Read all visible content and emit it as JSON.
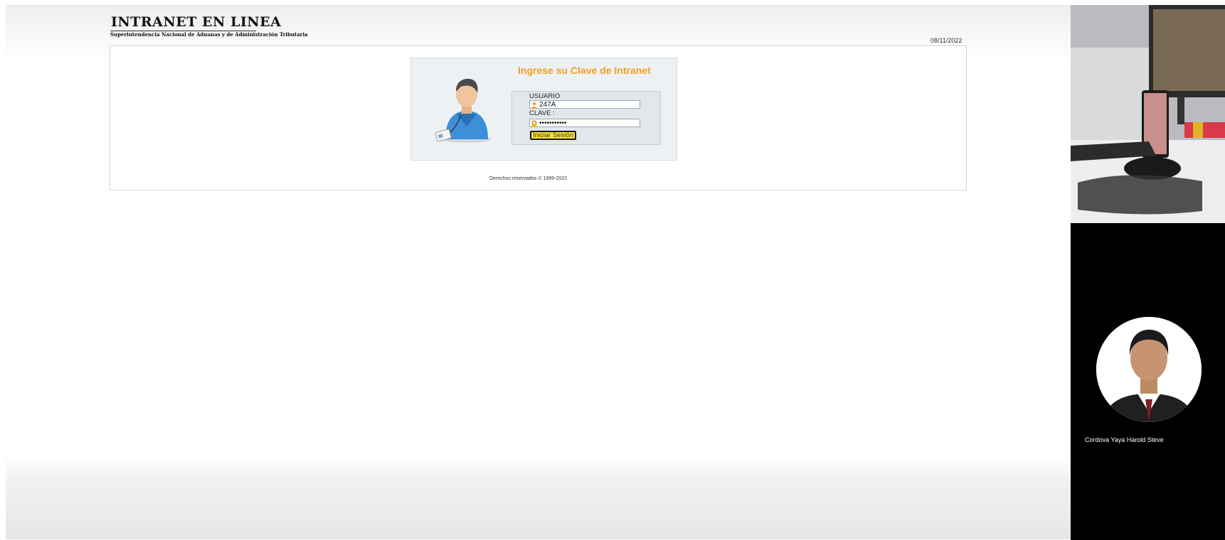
{
  "header": {
    "site_title": "INTRANET EN LINEA",
    "site_subtitle": "Superintendencia Nacional de Aduanas y de Administración Tributaria",
    "date": "08/11/2022"
  },
  "login": {
    "heading": "Ingrese su Clave de Intranet",
    "usuario_label": "USUARIO",
    "usuario_value": "247A",
    "clave_label": "CLAVE :",
    "clave_value": "•••••••••••",
    "submit_label": "Iniciar Sesión"
  },
  "footer": {
    "copyright": "Derechos reservados © 1999-2022"
  },
  "video_call": {
    "participant_name": "Cordova Yaya Harold Steve"
  },
  "icons": {
    "user_field": "user-icon",
    "password_field": "lock-icon",
    "avatar": "user-avatar-illustration"
  },
  "colors": {
    "heading": "#f0a020",
    "button": "#f6e33a"
  }
}
